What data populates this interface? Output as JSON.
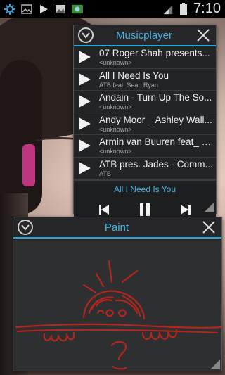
{
  "status_bar": {
    "time": "7:10",
    "icons": [
      "settings-icon",
      "image-icon",
      "play-icon",
      "picture-icon",
      "app-icon"
    ]
  },
  "music_window": {
    "title": "Musicplayer",
    "tracks": [
      {
        "title": "07 Roger Shah presents...",
        "artist": "<unknown>"
      },
      {
        "title": "All I Need Is You",
        "artist": "ATB feat. Sean Ryan"
      },
      {
        "title": "Andain - Turn Up The So...",
        "artist": "<unknown>"
      },
      {
        "title": "Andy Moor _ Ashley Wall...",
        "artist": "<unknown>"
      },
      {
        "title": "Armin van Buuren feat_ E...",
        "artist": "<unknown>"
      },
      {
        "title": "ATB pres. Jades - Comm...",
        "artist": "ATB"
      }
    ],
    "now_playing": "All I Need Is You",
    "accent": "#42b4e6"
  },
  "paint_window": {
    "title": "Paint",
    "stroke_color": "#b3261e"
  }
}
